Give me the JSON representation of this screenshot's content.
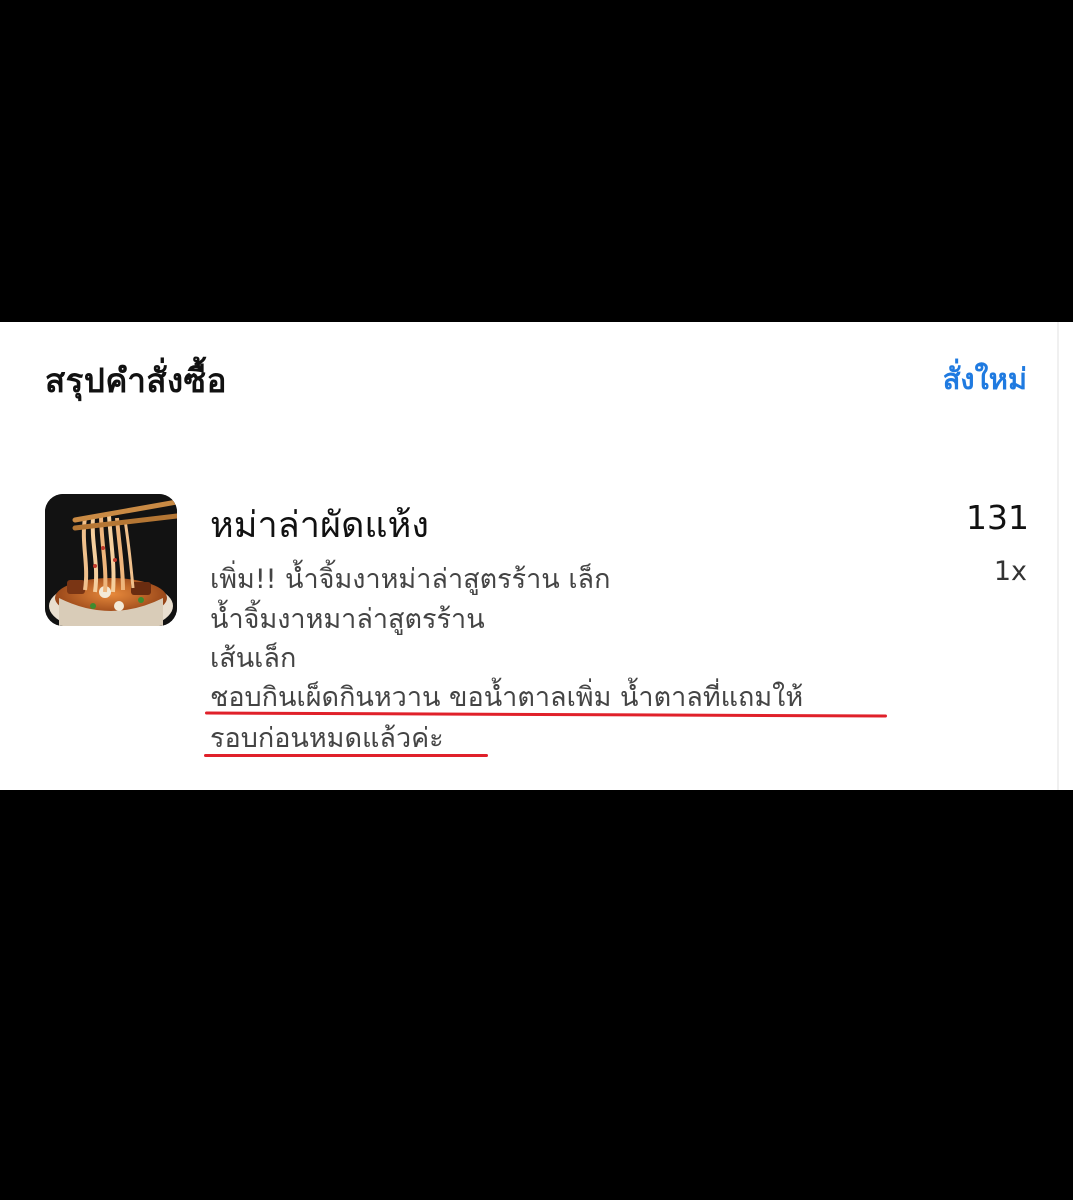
{
  "order_summary": {
    "title": "สรุปคำสั่งซื้อ",
    "reorder_label": "สั่งใหม่"
  },
  "item": {
    "image": "noodle-dish-photo",
    "name": "หม่าล่าผัดแห้ง",
    "price": "131",
    "quantity": "1x",
    "options": [
      "เพิ่ม!! น้ำจิ้มงาหม่าล่าสูตรร้าน เล็ก",
      "น้ำจิ้มงาหมาล่าสูตรร้าน",
      "เส้นเล็ก"
    ],
    "note_lines": [
      "ชอบกินเผ็ดกินหวาน ขอน้ำตาลเพิ่ม น้ำตาลที่แถมให้",
      "รอบก่อนหมดแล้วค่ะ"
    ]
  },
  "colors": {
    "accent": "#1f7ae0",
    "highlight_underline": "#e0202a",
    "background": "#000000",
    "card": "#ffffff"
  }
}
